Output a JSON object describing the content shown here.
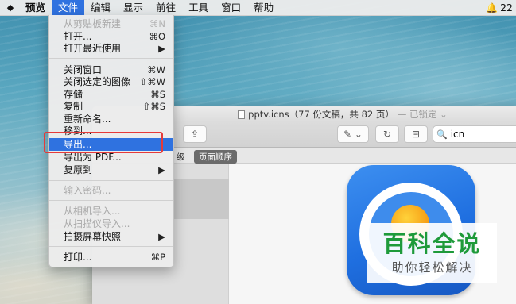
{
  "menubar": {
    "apple_icon": "apple-logo-icon",
    "items": [
      "预览",
      "文件",
      "编辑",
      "显示",
      "前往",
      "工具",
      "窗口",
      "帮助"
    ],
    "active_item": "文件",
    "status_badge": "22"
  },
  "file_menu": {
    "items": [
      {
        "label": "从剪贴板新建",
        "shortcut": "⌘N",
        "disabled": true
      },
      {
        "label": "打开...",
        "shortcut": "⌘O"
      },
      {
        "label": "打开最近使用",
        "shortcut": "▶"
      },
      {
        "label": "关闭窗口",
        "shortcut": "⌘W"
      },
      {
        "label": "关闭选定的图像",
        "shortcut": "⇧⌘W"
      },
      {
        "label": "存储",
        "shortcut": "⌘S"
      },
      {
        "label": "复制",
        "shortcut": "⇧⌘S"
      },
      {
        "label": "重新命名...",
        "shortcut": ""
      },
      {
        "label": "移到...",
        "shortcut": ""
      },
      {
        "label": "导出...",
        "shortcut": "",
        "highlighted": true
      },
      {
        "label": "导出为 PDF...",
        "shortcut": ""
      },
      {
        "label": "复原到",
        "shortcut": "▶"
      },
      {
        "label": "输入密码...",
        "shortcut": "",
        "disabled": true
      },
      {
        "label": "从相机导入...",
        "shortcut": "",
        "disabled": true
      },
      {
        "label": "从扫描仪导入...",
        "shortcut": "",
        "disabled": true
      },
      {
        "label": "拍摄屏幕快照",
        "shortcut": "▶"
      },
      {
        "label": "打印...",
        "shortcut": "⌘P"
      }
    ]
  },
  "window": {
    "title": "pptv.icns（77 份文稿，共 82 页）",
    "lock_status": "— 已锁定 ⌄",
    "search_value": "icn",
    "view_tabs": [
      "级",
      "页面顺序"
    ]
  },
  "watermark": {
    "title": "百科全说",
    "subtitle": "助你轻松解决"
  },
  "colors": {
    "menu_highlight": "#2f72e0",
    "annotation_box": "#e53a3a",
    "watermark_green": "#1e9a3a"
  }
}
